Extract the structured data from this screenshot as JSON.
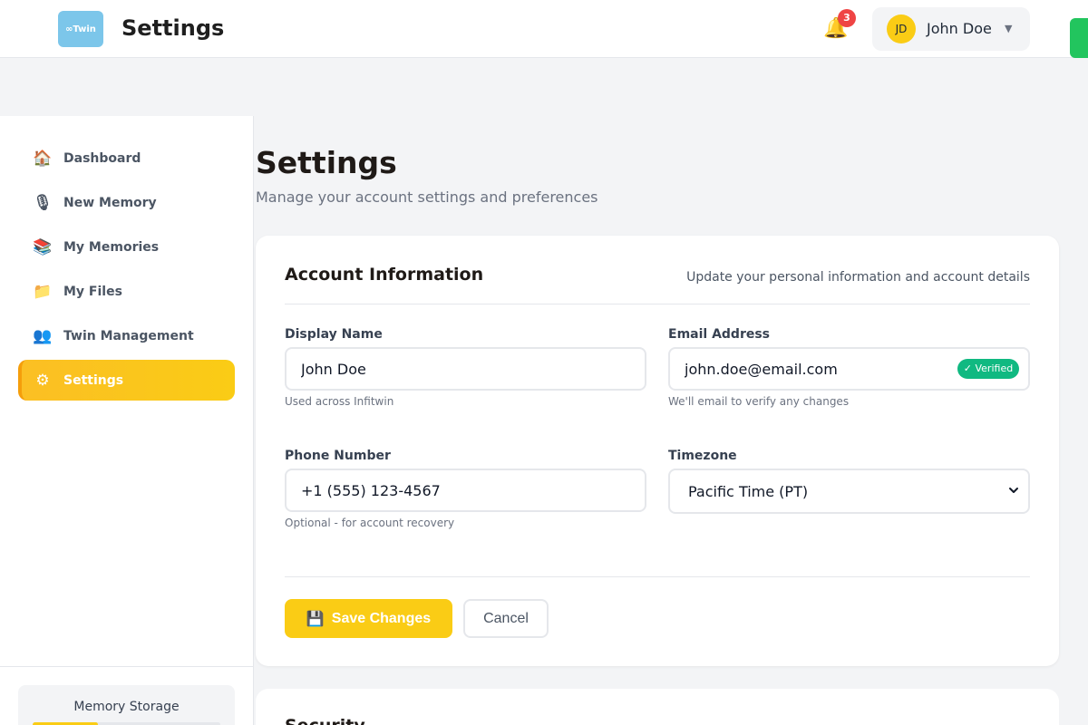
{
  "header": {
    "logo_text": "∞Twin",
    "title": "Settings",
    "notification_count": "3",
    "user_initials": "JD",
    "user_name": "John Doe"
  },
  "sidebar": {
    "items": [
      {
        "label": "Dashboard",
        "icon": "🏠",
        "icon_name": "home-icon",
        "active": false
      },
      {
        "label": "New Memory",
        "icon": "🎙",
        "icon_name": "microphone-icon",
        "active": false
      },
      {
        "label": "My Memories",
        "icon": "📚",
        "icon_name": "books-icon",
        "active": false
      },
      {
        "label": "My Files",
        "icon": "📁",
        "icon_name": "folder-icon",
        "active": false
      },
      {
        "label": "Twin Management",
        "icon": "👥",
        "icon_name": "users-icon",
        "active": false
      },
      {
        "label": "Settings",
        "icon": "⚙",
        "icon_name": "gear-icon",
        "active": true
      }
    ],
    "storage": {
      "label": "Memory Storage",
      "used_fraction": 0.35
    }
  },
  "page": {
    "title": "Settings",
    "subtitle": "Manage your account settings and preferences"
  },
  "account_card": {
    "title": "Account Information",
    "description": "Update your personal information and account details",
    "display_name": {
      "label": "Display Name",
      "value": "John Doe",
      "help": "Used across Infitwin"
    },
    "email": {
      "label": "Email Address",
      "value": "john.doe@email.com",
      "badge": "✓ Verified",
      "help": "We'll email to verify any changes"
    },
    "phone": {
      "label": "Phone Number",
      "value": "+1 (555) 123-4567",
      "help": "Optional - for account recovery"
    },
    "timezone": {
      "label": "Timezone",
      "value": "Pacific Time (PT)"
    },
    "save_label": "Save Changes",
    "cancel_label": "Cancel"
  },
  "security_card": {
    "title": "Security"
  },
  "colors": {
    "accent": "#facc15",
    "success": "#10b981",
    "danger": "#ef4444",
    "logo": "#7cc6ea"
  }
}
